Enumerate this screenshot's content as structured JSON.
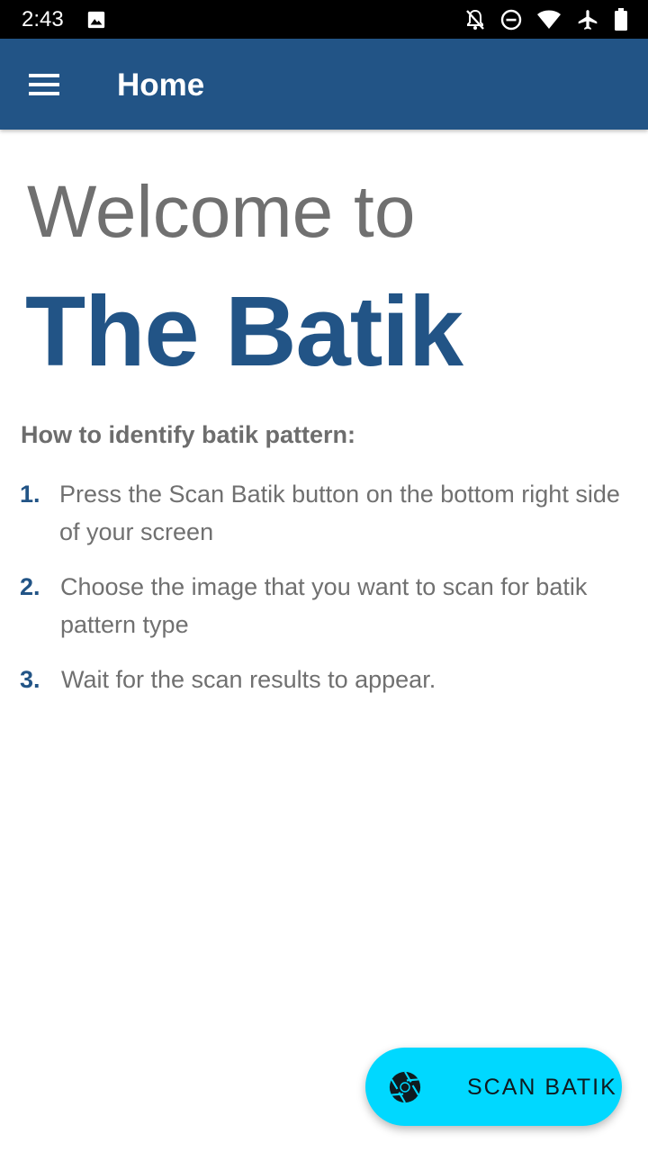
{
  "status_bar": {
    "time": "2:43",
    "left_icons": [
      "image-icon"
    ],
    "right_icons": [
      "notifications-off-icon",
      "do-not-disturb-icon",
      "wifi-icon",
      "airplane-mode-icon",
      "battery-icon"
    ]
  },
  "app_bar": {
    "title": "Home",
    "menu_icon": "hamburger-menu-icon",
    "color": "#225486"
  },
  "welcome": {
    "line1": "Welcome to",
    "line2": "The Batik"
  },
  "instructions": {
    "heading": "How to identify batik pattern:",
    "steps": [
      {
        "number": "1.",
        "text": "Press the Scan Batik button on the bottom right side of your screen"
      },
      {
        "number": "2.",
        "text": "Choose the image that you want to scan for batik pattern type"
      },
      {
        "number": "3.",
        "text": "Wait for the scan results to appear."
      }
    ]
  },
  "fab": {
    "label": "SCAN BATIK",
    "icon": "camera-shutter-icon",
    "color": "#00d8ff"
  }
}
